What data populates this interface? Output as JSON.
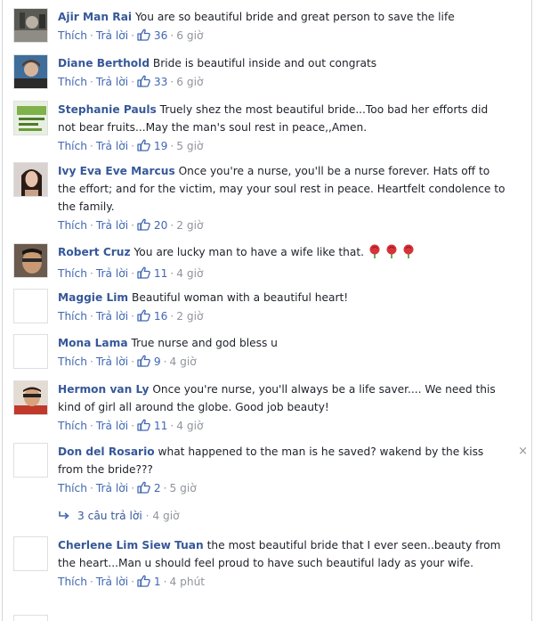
{
  "labels": {
    "like": "Thích",
    "reply": "Trả lời",
    "dot": "·"
  },
  "comments": [
    {
      "author": "Ajir Man Rai",
      "text": "You are so beautiful bride and great person to save the life",
      "likes": "36",
      "time": "6 giờ",
      "avatar": "photo-dark"
    },
    {
      "author": "Diane Berthold",
      "text": "Bride is beautiful inside and out congrats",
      "likes": "33",
      "time": "6 giờ",
      "avatar": "photo-blue"
    },
    {
      "author": "Stephanie Pauls",
      "text": "Truely shez the most beautiful bride...Too bad her efforts did not bear fruits...May the man's soul rest in peace,,Amen.",
      "likes": "19",
      "time": "5 giờ",
      "avatar": "photo-green"
    },
    {
      "author": "Ivy Eva Eve Marcus",
      "text": "Once you're a nurse, you'll be a nurse forever. Hats off to the effort; and for the victim, may your soul rest in peace. Heartfelt condolence to the family.",
      "likes": "20",
      "time": "2 giờ",
      "avatar": "photo-woman"
    },
    {
      "author": "Robert Cruz",
      "text": "You are lucky man to have a wife like that.",
      "likes": "11",
      "time": "4 giờ",
      "avatar": "photo-face",
      "emoji": "rose-emoji"
    },
    {
      "author": "Maggie Lim",
      "text": "Beautiful woman with a beautiful heart!",
      "likes": "16",
      "time": "2 giờ",
      "avatar": "blank"
    },
    {
      "author": "Mona Lama",
      "text": "True nurse and god bless u",
      "likes": "9",
      "time": "4 giờ",
      "avatar": "blank"
    },
    {
      "author": "Hermon van Ly",
      "text": "Once you're nurse, you'll always be a life saver.... We need this kind of girl all around the globe. Good job beauty!",
      "likes": "11",
      "time": "4 giờ",
      "avatar": "photo-red"
    },
    {
      "author": "Don del Rosario",
      "text": "what happened to the man is he saved? wakend by the kiss from the bride???",
      "likes": "2",
      "time": "5 giờ",
      "avatar": "blank",
      "close": "×"
    },
    {
      "author": "Cherlene Lim Siew Tuan",
      "text": "the most beautiful bride that I ever seen..beauty from the heart...Man u should feel proud to have such beautiful lady as your wife.",
      "likes": "1",
      "time": "4 phút",
      "avatar": "blank"
    }
  ],
  "replies": {
    "label": "3 câu trả lời",
    "time": "4 giờ"
  },
  "colors": {
    "author": "#365899",
    "link": "#4267b2",
    "meta": "#90949c",
    "text": "#1d2129"
  }
}
